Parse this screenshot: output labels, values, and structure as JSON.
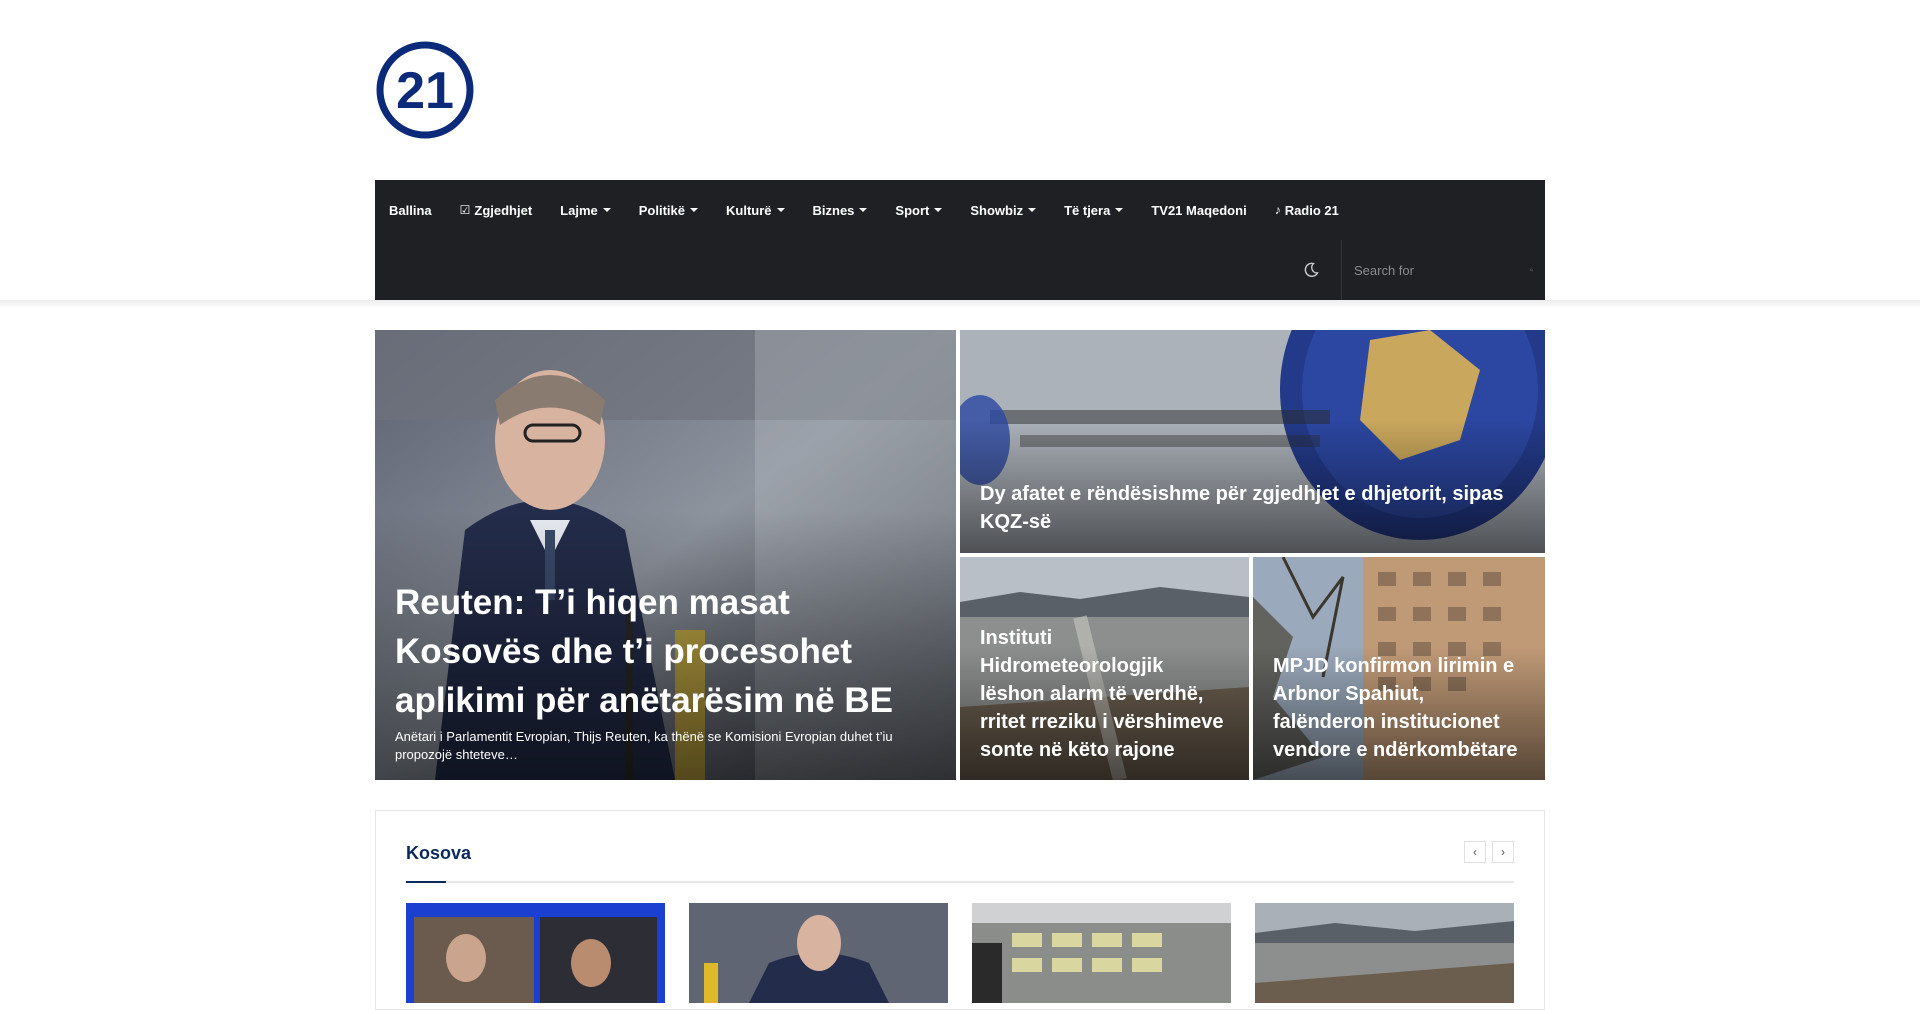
{
  "logo": {
    "text": "21",
    "color": "#0b2a7a"
  },
  "nav": {
    "items": [
      {
        "label": "Ballina",
        "caret": false,
        "icon": ""
      },
      {
        "label": "Zgjedhjet",
        "caret": false,
        "icon": "checkbox-icon"
      },
      {
        "label": "Lajme",
        "caret": true,
        "icon": ""
      },
      {
        "label": "Politikë",
        "caret": true,
        "icon": ""
      },
      {
        "label": "Kulturë",
        "caret": true,
        "icon": ""
      },
      {
        "label": "Biznes",
        "caret": true,
        "icon": ""
      },
      {
        "label": "Sport",
        "caret": true,
        "icon": ""
      },
      {
        "label": "Showbiz",
        "caret": true,
        "icon": ""
      },
      {
        "label": "Të tjera",
        "caret": true,
        "icon": ""
      },
      {
        "label": "TV21 Maqedoni",
        "caret": false,
        "icon": ""
      },
      {
        "label": "Radio 21",
        "caret": false,
        "icon": "microphone-icon"
      }
    ],
    "search_placeholder": "Search for"
  },
  "hero": {
    "main": {
      "title": "Reuten: T’i hiqen masat Kosovës dhe t’i procesohet aplikimi për anëtarësim në BE",
      "excerpt": "Anëtari i Parlamentit Evropian, Thijs Reuten, ka thënë se Komisioni Evropian duhet t’iu propozojë shteteve…"
    },
    "top_right": {
      "title": "Dy afatet e rëndësishme për zgjedhjet e dhjetorit, sipas KQZ-së"
    },
    "bottom_left": {
      "title": "Instituti Hidrometeorologjik lëshon alarm të verdhë, rritet rreziku i vërshimeve sonte në këto rajone"
    },
    "bottom_right": {
      "title": "MPJD konfirmon lirimin e Arbnor Spahiut, falënderon institucionet vendore e ndërkombëtare"
    }
  },
  "section": {
    "title": "Kosova"
  }
}
